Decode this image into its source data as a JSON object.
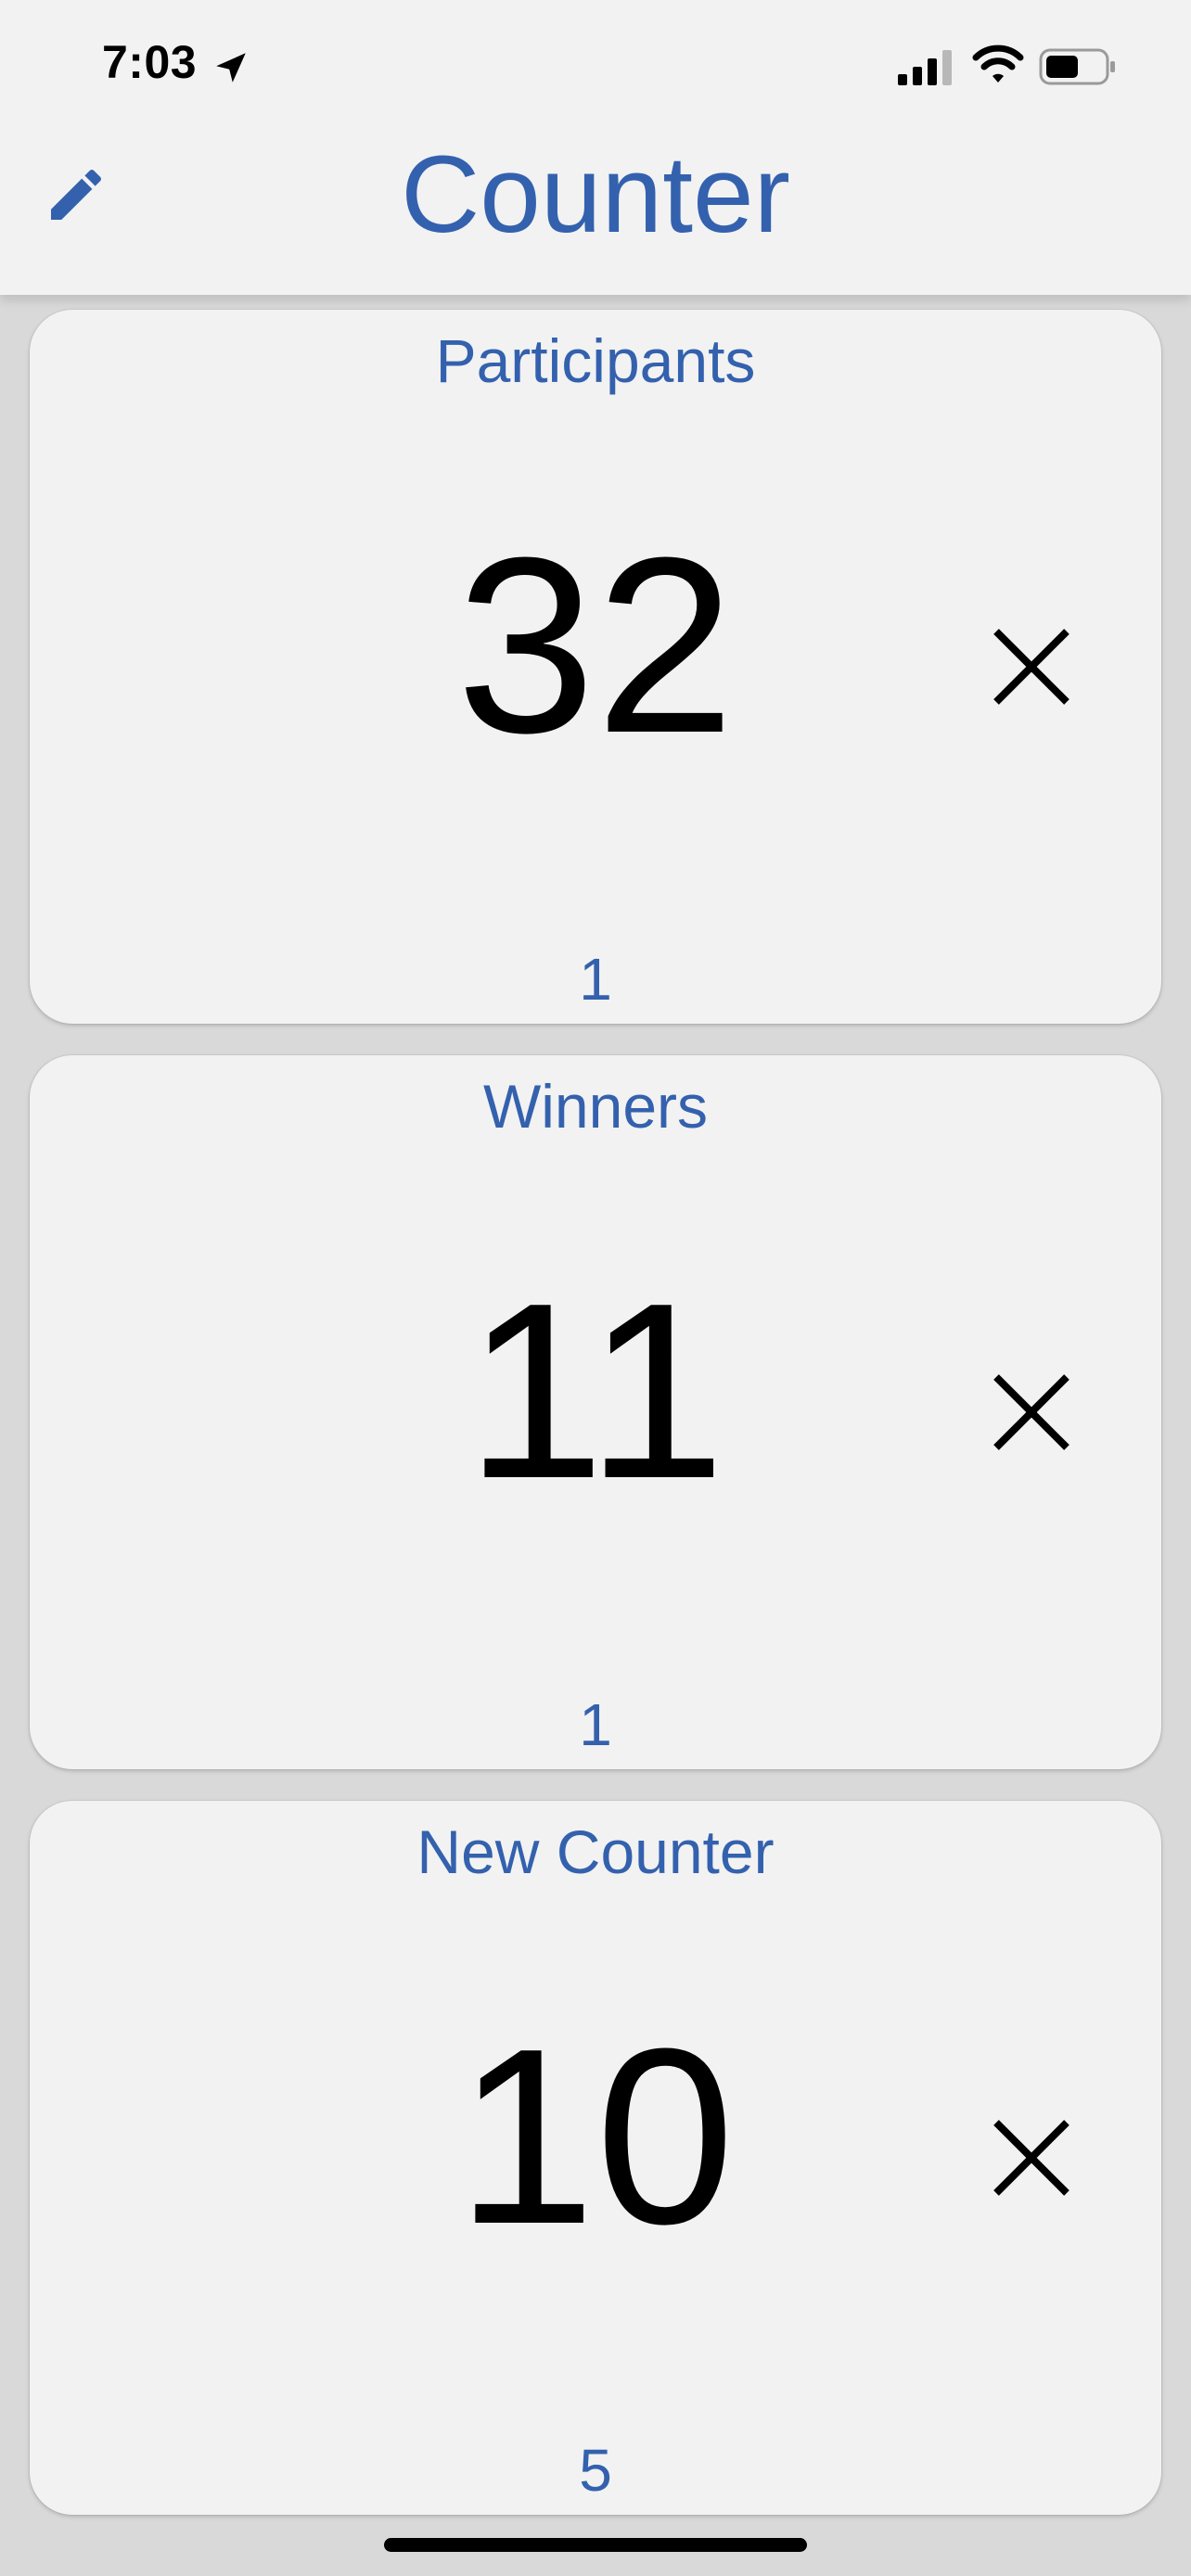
{
  "status_bar": {
    "time": "7:03",
    "location_icon": "location-arrow-icon",
    "signal_icon": "cellular-signal-icon",
    "wifi_icon": "wifi-icon",
    "battery_icon": "battery-icon"
  },
  "header": {
    "title": "Counter",
    "edit_icon": "pencil-icon"
  },
  "counters": [
    {
      "name": "Participants",
      "value": "32",
      "step": "1"
    },
    {
      "name": "Winners",
      "value": "11",
      "step": "1"
    },
    {
      "name": "New Counter",
      "value": "10",
      "step": "5"
    }
  ],
  "colors": {
    "accent": "#3461ae",
    "background": "#d9d9d9",
    "card": "#f2f2f2"
  }
}
